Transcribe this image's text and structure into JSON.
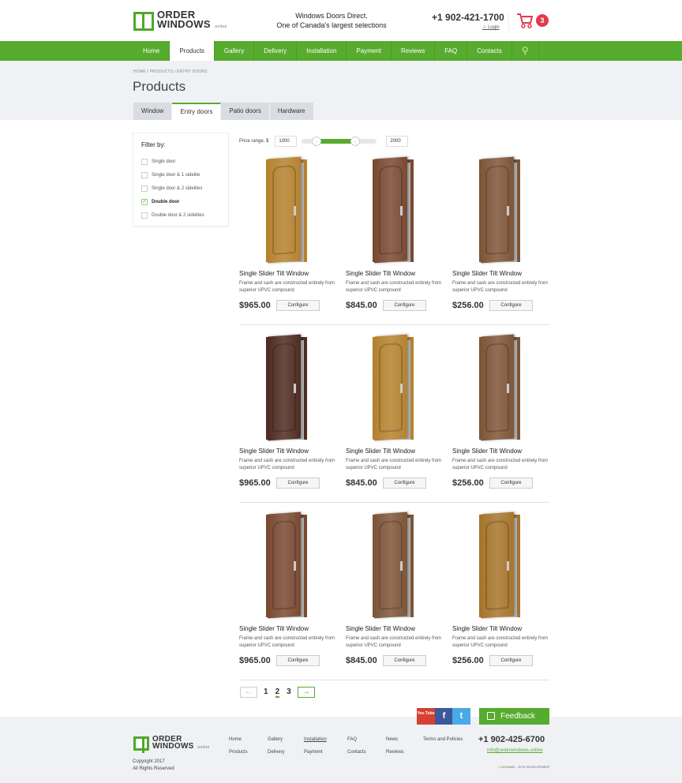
{
  "header": {
    "logo_line1": "ORDER",
    "logo_line2": "WINDOWS",
    "logo_suffix": ".online",
    "tagline1": "Windows Doors Direct.",
    "tagline2": "One of Canada's largest selections",
    "phone": "+1 902-421-1700",
    "login": "Login",
    "cart_count": "3"
  },
  "nav": [
    "Home",
    "Products",
    "Gallery",
    "Delivery",
    "Installation",
    "Payment",
    "Reviews",
    "FAQ",
    "Contacts"
  ],
  "nav_active": 1,
  "breadcrumb": "HOME  /  PRODUCTS  /  ENTRY DOORS",
  "page_title": "Products",
  "tabs": [
    "Window",
    "Entry doors",
    "Patio doors",
    "Hardware"
  ],
  "tab_active": 1,
  "filter": {
    "title": "Filter by:",
    "options": [
      {
        "label": "Single door",
        "checked": false
      },
      {
        "label": "Single door & 1 sidelite",
        "checked": false
      },
      {
        "label": "Single door & 2 sidelites",
        "checked": false
      },
      {
        "label": "Double door",
        "checked": true
      },
      {
        "label": "Double door & 2 sidelites",
        "checked": false
      }
    ]
  },
  "price_range": {
    "label": "Price range, $",
    "min": "1000",
    "max": "2000",
    "slider_low_pct": 20,
    "slider_high_pct": 71
  },
  "products": [
    {
      "title": "Single Slider Tilt Window",
      "desc": "Frame and sash are constructed entirely from superior UPVC compound",
      "price": "$965.00",
      "button": "Configure",
      "color": "#b5822f"
    },
    {
      "title": "Single Slider Tilt Window",
      "desc": "Frame and sash are constructed entirely from superior UPVC compound",
      "price": "$845.00",
      "button": "Configure",
      "color": "#7a4a32"
    },
    {
      "title": "Single Slider Tilt Window",
      "desc": "Frame and sash are constructed entirely from superior UPVC compound",
      "price": "$256.00",
      "button": "Configure",
      "color": "#7e5538"
    },
    {
      "title": "Single Slider Tilt Window",
      "desc": "Frame and sash are constructed entirely from superior UPVC compound",
      "price": "$965.00",
      "button": "Configure",
      "color": "#4f2c22"
    },
    {
      "title": "Single Slider Tilt Window",
      "desc": "Frame and sash are constructed entirely from superior UPVC compound",
      "price": "$845.00",
      "button": "Configure",
      "color": "#b5822f"
    },
    {
      "title": "Single Slider Tilt Window",
      "desc": "Frame and sash are constructed entirely from superior UPVC compound",
      "price": "$256.00",
      "button": "Configure",
      "color": "#7e5538"
    },
    {
      "title": "Single Slider Tilt Window",
      "desc": "Frame and sash are constructed entirely from superior UPVC compound",
      "price": "$965.00",
      "button": "Configure",
      "color": "#7a4a32"
    },
    {
      "title": "Single Slider Tilt Window",
      "desc": "Frame and sash are constructed entirely from superior UPVC compound",
      "price": "$845.00",
      "button": "Configure",
      "color": "#7e5538"
    },
    {
      "title": "Single Slider Tilt Window",
      "desc": "Frame and sash are constructed entirely from superior UPVC compound",
      "price": "$256.00",
      "button": "Configure",
      "color": "#a7752c"
    }
  ],
  "pagination": {
    "pages": [
      "1",
      "2",
      "3"
    ],
    "current": "2",
    "prev": "←",
    "next": "→"
  },
  "social": {
    "youtube": "You Tube",
    "facebook": "f",
    "twitter": "t"
  },
  "feedback": "Feedback",
  "footer": {
    "logo_line1": "ORDER",
    "logo_line2": "WINDOWS",
    "logo_suffix": ".online",
    "copyright1": "Copyright 2017",
    "copyright2": "All Rights Reserved",
    "links": [
      "Home",
      "Products",
      "Gallery",
      "Delivery",
      "Installation",
      "Payment",
      "FAQ",
      "Contacts",
      "News",
      "Reviews",
      "Terms and Policies"
    ],
    "phone": "+1 902-425-6700",
    "email": "info@orderwindows.online",
    "developer": "GOXAME – SITE DEVELOPMENT"
  },
  "colors": {
    "brand": "#57ab2e",
    "cart_badge": "#e23a4f"
  }
}
